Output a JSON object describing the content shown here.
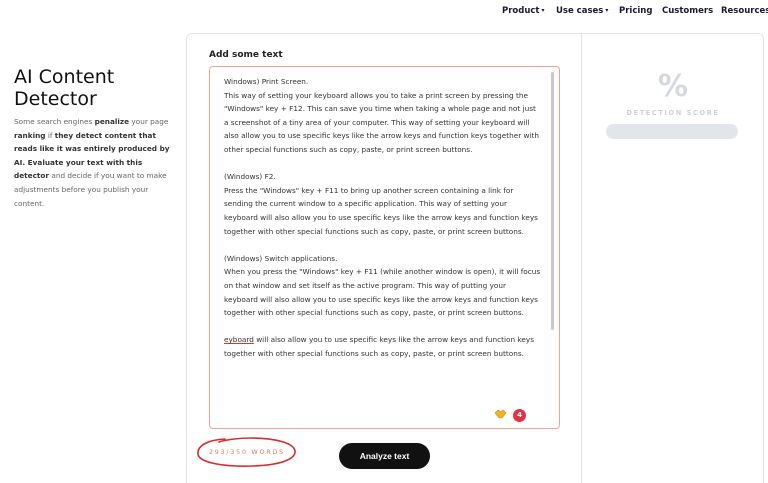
{
  "nav": {
    "items": [
      {
        "label": "Product",
        "caret": "▾"
      },
      {
        "label": "Use cases",
        "caret": "▾"
      },
      {
        "label": "Pricing",
        "caret": ""
      },
      {
        "label": "Customers",
        "caret": ""
      },
      {
        "label": "Resources",
        "caret": "▾"
      }
    ]
  },
  "intro": {
    "title": "AI Content Detector",
    "desc": {
      "p1": "Some search engines ",
      "b1": "penalize",
      "p2": " your page ",
      "b2": "ranking",
      "p3": " if ",
      "b3": "they detect content that reads like it was entirely produced by AI. Evaluate your text with this detector",
      "p4": " and decide if you want to make adjustments before you publish your content."
    }
  },
  "editor": {
    "label": "Add some text",
    "paragraphs": [
      "Windows) Print Screen.\nThis way of setting your keyboard allows you to take a print screen by pressing the \"Windows\" key + F12. This can save you time when taking a whole page and not just a screenshot of a tiny area of your computer. This way of setting your keyboard will also allow you to use specific keys like the arrow keys and function keys together with other special functions such as copy, paste, or print screen buttons.",
      "(Windows) F2.\nPress the \"Windows\" key + F11 to bring up another screen containing a link for sending the current window to a specific application. This way of setting your keyboard will also allow you to use specific keys like the arrow keys and function keys together with other special functions such as copy, paste, or print screen buttons.",
      "(Windows) Switch applications.\nWhen you press the \"Windows\" key + F11 (while another window is open), it will focus on that window and set itself as the active program. This way of putting your keyboard will also allow you to use specific keys like the arrow keys and function keys together with other special functions such as copy, paste, or print screen buttons."
    ],
    "last_underlined": "eyboard",
    "last_rest": " will also allow you to use specific keys like the arrow keys and function keys together with other special functions such as copy, paste, or print screen buttons.",
    "grammar_icon": "handshake-icon",
    "issues_count": "4"
  },
  "word_count": "293/350 WORDS",
  "analyze_button": "Analyze text",
  "score": {
    "symbol": "%",
    "label": "DETECTION SCORE"
  },
  "colors": {
    "accent": "#e07b5a",
    "annotation_red": "#d92b2b",
    "badge_red": "#e03345",
    "button_dark": "#111111",
    "muted": "#d5d8de"
  }
}
